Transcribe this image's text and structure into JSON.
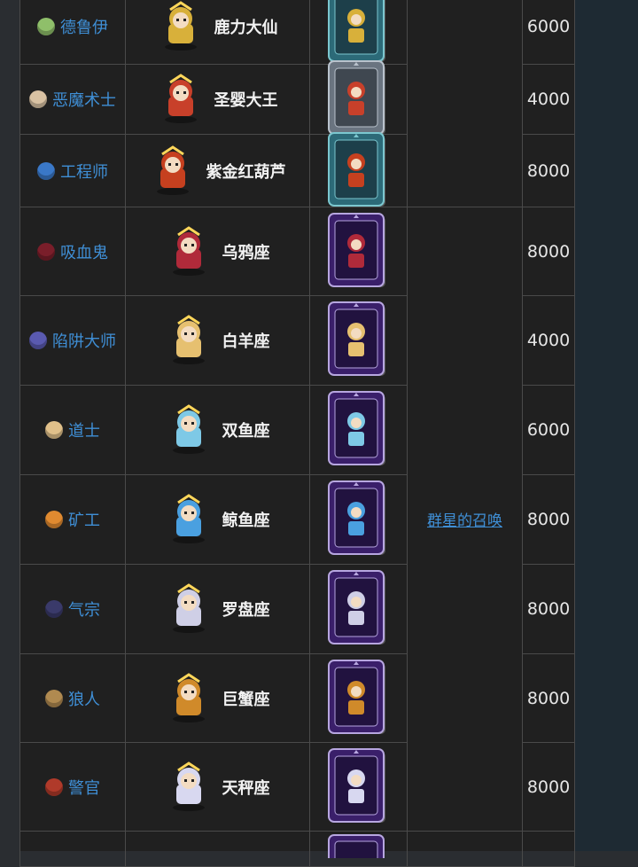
{
  "rows": [
    {
      "character": "德鲁伊",
      "skin": "鹿力大仙",
      "price": "6000",
      "card_style": "tree",
      "face": "#8fbf6a",
      "skin_color": "#d8b03a"
    },
    {
      "character": "恶魔术士",
      "skin": "圣婴大王",
      "price": "4000",
      "card_style": "stone",
      "face": "#d9c2a3",
      "skin_color": "#c8402a"
    },
    {
      "character": "工程师",
      "skin": "紫金红葫芦",
      "price": "8000",
      "card_style": "tree",
      "face": "#3a78c8",
      "skin_color": "#c6401f"
    },
    {
      "character": "吸血鬼",
      "skin": "乌鸦座",
      "price": "8000",
      "card_style": "star",
      "face": "#7a1e2a",
      "skin_color": "#b02a3a"
    },
    {
      "character": "陷阱大师",
      "skin": "白羊座",
      "price": "4000",
      "card_style": "star",
      "face": "#5a5ab0",
      "skin_color": "#e6c070"
    },
    {
      "character": "道士",
      "skin": "双鱼座",
      "price": "6000",
      "card_style": "star",
      "face": "#e0c08a",
      "skin_color": "#7ec9e6"
    },
    {
      "character": "矿工",
      "skin": "鲸鱼座",
      "price": "8000",
      "card_style": "star",
      "face": "#e08a30",
      "skin_color": "#4aa0e0"
    },
    {
      "character": "气宗",
      "skin": "罗盘座",
      "price": "8000",
      "card_style": "star",
      "face": "#3a3a6a",
      "skin_color": "#cfcfe6"
    },
    {
      "character": "狼人",
      "skin": "巨蟹座",
      "price": "8000",
      "card_style": "star",
      "face": "#b08a50",
      "skin_color": "#d08a2a"
    },
    {
      "character": "警官",
      "skin": "天秤座",
      "price": "8000",
      "card_style": "star",
      "face": "#b03a2a",
      "skin_color": "#d8d8f0"
    }
  ],
  "event": "群星的召唤",
  "colors": {
    "link": "#3f8fd6",
    "border": "#4a4a4a",
    "cell_bg": "#202020",
    "card_purple": "#3a1f6a",
    "card_tree": "#2c6a78",
    "card_stone": "#6a7480"
  }
}
